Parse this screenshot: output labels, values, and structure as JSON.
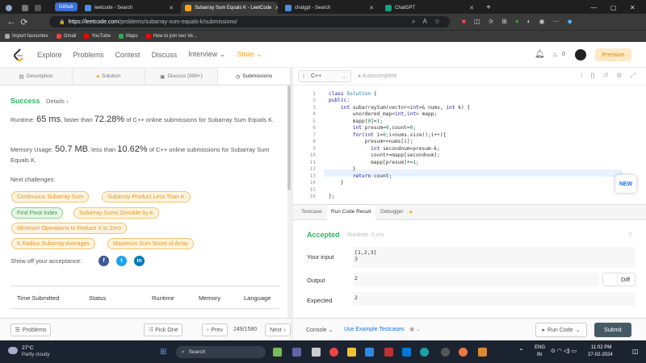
{
  "browser": {
    "tabs": [
      {
        "label": "Github",
        "active": false
      },
      {
        "label": "leetcode - Search",
        "active": false
      },
      {
        "label": "Subarray Sum Equals K - LeetCode",
        "active": true
      },
      {
        "label": "chatgpt - Search",
        "active": false
      },
      {
        "label": "ChatGPT",
        "active": false
      }
    ],
    "url_host": "https://leetcode.com",
    "url_path": "/problems/subarray-sum-equals-k/submissions/",
    "bookmarks": [
      "Import favourites",
      "Gmail",
      "YouTube",
      "Maps",
      "How to join two Ve..."
    ]
  },
  "header": {
    "nav": [
      "Explore",
      "Problems",
      "Contest",
      "Discuss",
      "Interview ⌄",
      "Store ⌄"
    ],
    "notif_count": "0",
    "premium": "Premium"
  },
  "left_tabs": [
    {
      "label": "Description",
      "icon": "description-icon"
    },
    {
      "label": "Solution",
      "icon": "lock-icon"
    },
    {
      "label": "Discuss (999+)",
      "icon": "discuss-icon"
    },
    {
      "label": "Submissions",
      "icon": "clock-icon"
    }
  ],
  "result": {
    "status": "Success",
    "details": "Details",
    "runtime_label": "Runtime:",
    "runtime_value": "65 ms",
    "runtime_mid": ", faster than",
    "runtime_pct": "72.28%",
    "runtime_tail": "of C++ online submissions for Subarray Sum Equals K.",
    "memory_label": "Memory Usage:",
    "memory_value": "50.7 MB",
    "memory_mid": ", less than",
    "memory_pct": "10.62%",
    "memory_tail": "of C++ online submissions for Subarray Sum Equals K.",
    "next_label": "Next challenges:",
    "challenges": [
      {
        "label": "Continuous Subarray Sum",
        "color": "orange"
      },
      {
        "label": "Subarray Product Less Than K",
        "color": "orange"
      },
      {
        "label": "Find Pivot Index",
        "color": "green"
      },
      {
        "label": "Subarray Sums Divisible by K",
        "color": "orange"
      },
      {
        "label": "Minimum Operations to Reduce X to Zero",
        "color": "orange"
      },
      {
        "label": "K Radius Subarray Averages",
        "color": "orange"
      },
      {
        "label": "Maximum Sum Score of Array",
        "color": "orange"
      }
    ],
    "share_label": "Show off your acceptance:",
    "table_headers": [
      "Time Submitted",
      "Status",
      "Runtime",
      "Memory",
      "Language"
    ]
  },
  "left_bottom": {
    "problems": "Problems",
    "pick_one": "Pick One",
    "prev": "Prev",
    "page": "249/1580",
    "next": "Next"
  },
  "editor": {
    "language": "C++",
    "autocomplete": "Autocomplete",
    "new_label": "NEW"
  },
  "run_tabs": [
    "Testcase",
    "Run Code Result",
    "Debugger"
  ],
  "run_result": {
    "status": "Accepted",
    "runtime": "Runtime: 0 ms",
    "input_label": "Your input",
    "input_line1": "[1,2,3]",
    "input_line2": "3",
    "output_label": "Output",
    "output_value": "2",
    "expected_label": "Expected",
    "expected_value": "2",
    "diff": "Diff"
  },
  "right_bottom": {
    "console": "Console",
    "use_example": "Use Example Testcases",
    "run_code": "Run Code",
    "submit": "Submit"
  },
  "taskbar": {
    "temp": "27°C",
    "weather": "Partly cloudy",
    "search": "Search",
    "lang1": "ENG",
    "lang2": "IN",
    "time": "11:02 PM",
    "date": "27-02-2024"
  },
  "colors": {
    "success": "#2db55d",
    "accent": "#1a73e8",
    "premium": "#ffa116"
  }
}
